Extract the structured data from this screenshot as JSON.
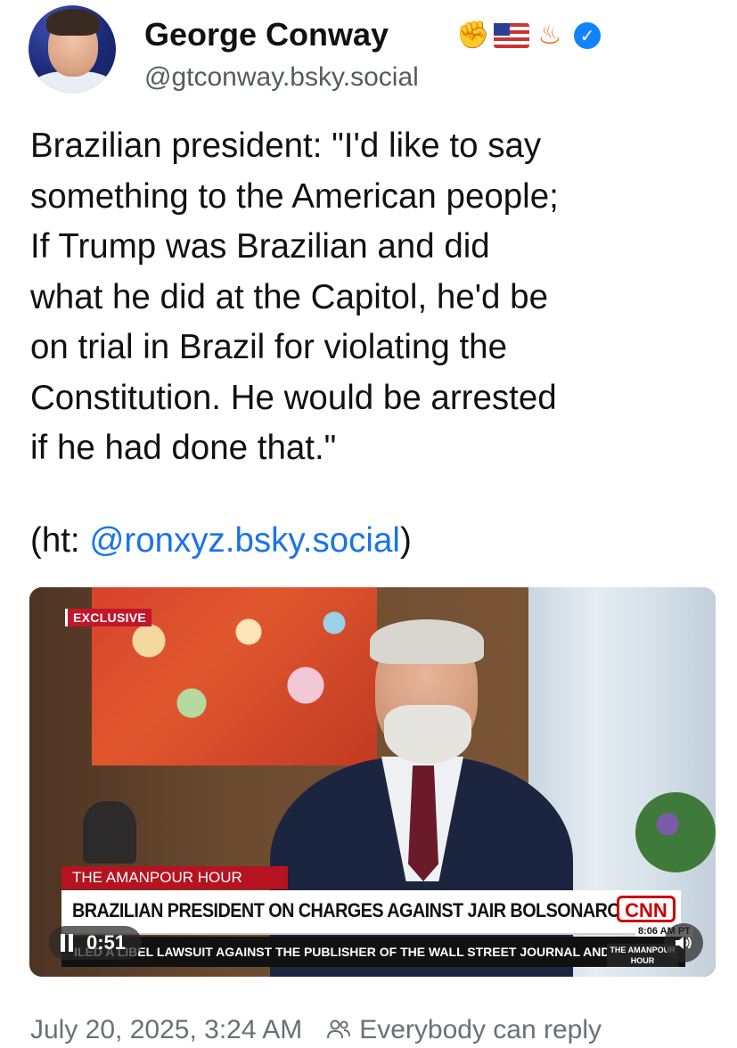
{
  "author": {
    "name": "George Conway",
    "handle": "@gtconway.bsky.social",
    "badge_emojis": [
      "fist-icon",
      "us-flag-icon",
      "fire-icon",
      "verified-check-icon"
    ]
  },
  "post": {
    "text": "Brazilian president: \"I'd like to say\nsomething to the American people;\nIf Trump was Brazilian and did\nwhat he did at the Capitol, he'd be\non trial in Brazil for violating the\nConstitution. He would be arrested\nif he had done that.\"",
    "ht_prefix": "(ht: ",
    "ht_mention": "@ronxyz.bsky.social",
    "ht_suffix": ")"
  },
  "video": {
    "exclusive_label": "EXCLUSIVE",
    "show_name": "THE AMANPOUR HOUR",
    "headline": "BRAZILIAN PRESIDENT ON CHARGES AGAINST JAIR BOLSONARO",
    "network_logo": "CNN",
    "clock": "8:06 AM PT",
    "program_badge": "THE AMANPOUR HOUR",
    "ticker": "ILED A LIBEL LAWSUIT AGAINST THE PUBLISHER OF THE WALL STREET JOURNAL AND",
    "time_remaining": "0:51",
    "state": "playing",
    "muted": false
  },
  "footer": {
    "timestamp": "July 20, 2025, 3:24 AM",
    "reply_setting": "Everybody can reply"
  },
  "colors": {
    "link": "#1a74e8",
    "verified": "#1183fe",
    "cnn_red": "#cc0000",
    "muted_text": "#6b7077"
  }
}
